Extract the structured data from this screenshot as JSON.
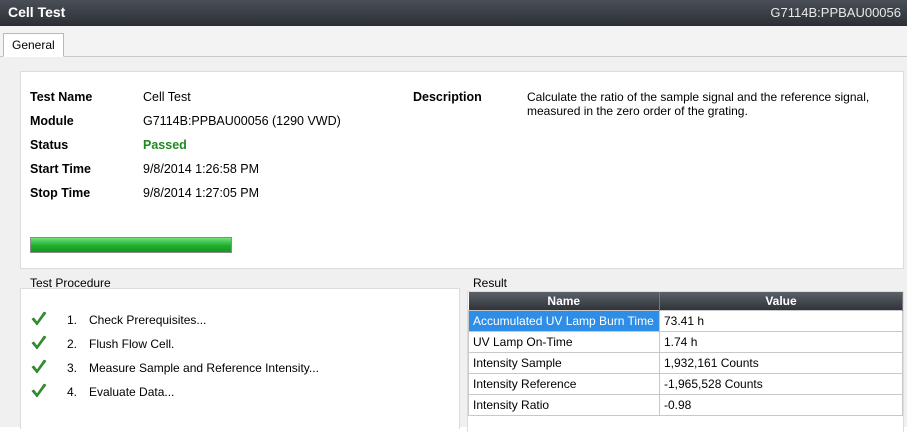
{
  "window": {
    "title": "Cell Test",
    "module_id": "G7114B:PPBAU00056"
  },
  "tabs": [
    {
      "label": "General",
      "active": true
    }
  ],
  "info": {
    "test_name_label": "Test Name",
    "test_name": "Cell Test",
    "module_label": "Module",
    "module": "G7114B:PPBAU00056 (1290 VWD)",
    "status_label": "Status",
    "status": "Passed",
    "start_label": "Start Time",
    "start_time": "9/8/2014 1:26:58 PM",
    "stop_label": "Stop Time",
    "stop_time": "9/8/2014 1:27:05 PM",
    "description_label": "Description",
    "description": "Calculate the ratio of the sample signal and the reference signal, measured in the zero order of the grating.",
    "progress_fraction": 1.0,
    "colors": {
      "status_passed": "#1f8a1f",
      "progress": "#1fae2f",
      "selection": "#2e8de6"
    }
  },
  "procedure": {
    "title": "Test Procedure",
    "steps": [
      {
        "num": "1.",
        "label": "Check Prerequisites...",
        "icon": "checkmark-icon"
      },
      {
        "num": "2.",
        "label": "Flush Flow Cell.",
        "icon": "checkmark-icon"
      },
      {
        "num": "3.",
        "label": "Measure Sample and Reference Intensity...",
        "icon": "checkmark-icon"
      },
      {
        "num": "4.",
        "label": "Evaluate Data...",
        "icon": "checkmark-icon"
      }
    ]
  },
  "result": {
    "title": "Result",
    "columns": [
      "Name",
      "Value"
    ],
    "rows": [
      {
        "name": "Accumulated UV Lamp Burn Time",
        "value": "73.41 h",
        "selected": true
      },
      {
        "name": "UV Lamp On-Time",
        "value": "1.74 h"
      },
      {
        "name": "Intensity Sample",
        "value": "1,932,161 Counts"
      },
      {
        "name": "Intensity Reference",
        "value": "-1,965,528 Counts"
      },
      {
        "name": "Intensity Ratio",
        "value": "-0.98"
      }
    ]
  }
}
